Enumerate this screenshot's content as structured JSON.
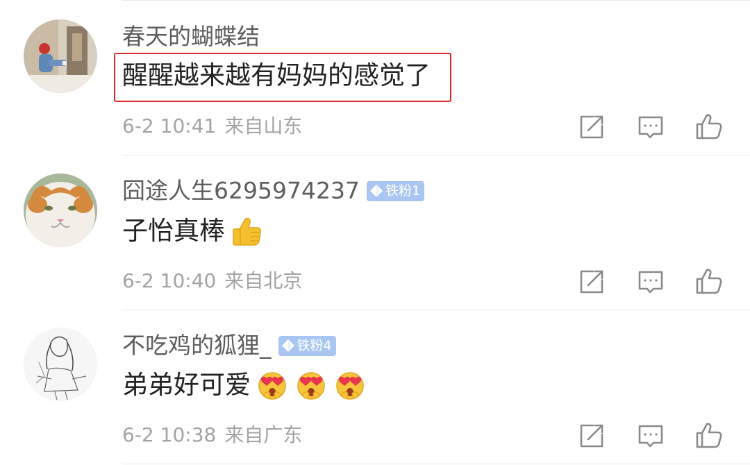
{
  "comments": [
    {
      "username": "春天的蝴蝶结",
      "badge": null,
      "text": "醒醒越来越有妈妈的感觉了",
      "time": "6-2 10:41",
      "location": "来自山东",
      "highlighted": true
    },
    {
      "username": "囧途人生6295974237",
      "badge": "铁粉1",
      "text": "子怡真棒",
      "emoji": [
        "thumbs-up-emoji"
      ],
      "time": "6-2 10:40",
      "location": "来自北京",
      "highlighted": false
    },
    {
      "username": "不吃鸡的狐狸_",
      "badge": "铁粉4",
      "text": "弟弟好可爱",
      "emoji": [
        "heart-eyes-emoji",
        "heart-eyes-emoji",
        "heart-eyes-emoji"
      ],
      "time": "6-2 10:38",
      "location": "来自广东",
      "highlighted": false
    }
  ],
  "actions": [
    "share-icon",
    "comment-icon",
    "like-icon"
  ],
  "colors": {
    "highlight_border": "#e0292b",
    "badge_bg": "#a9c6f2",
    "meta_text": "#a3a3a3",
    "username_text": "#5d5d5d",
    "content_text": "#222222"
  }
}
